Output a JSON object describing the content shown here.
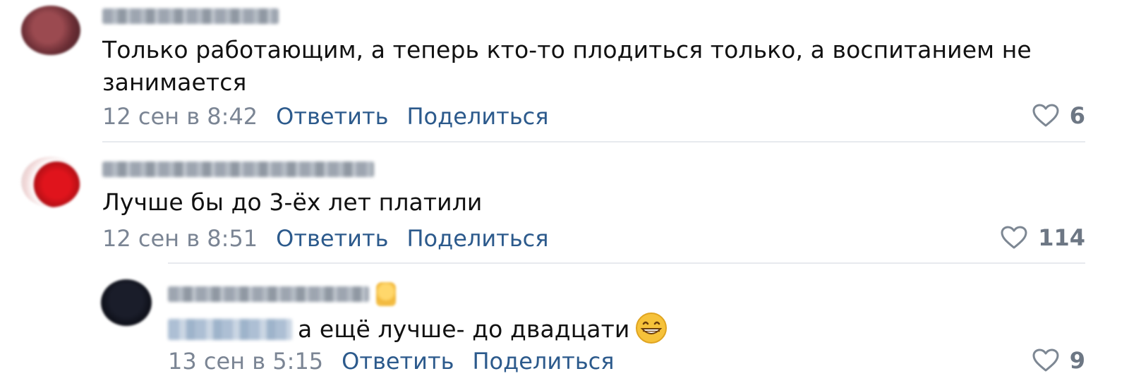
{
  "comments": [
    {
      "text": "Только работающим, а теперь кто-то плодиться только, а воспитанием не занимается",
      "time": "12 сен в 8:42",
      "reply_label": "Ответить",
      "share_label": "Поделиться",
      "likes": "6"
    },
    {
      "text": "Лучше бы до 3-ёх лет платили",
      "time": "12 сен в 8:51",
      "reply_label": "Ответить",
      "share_label": "Поделиться",
      "likes": "114"
    }
  ],
  "reply": {
    "text": "а ещё лучше- до двадцати",
    "emoji": "grinning-face",
    "time": "13 сен в 5:15",
    "reply_label": "Ответить",
    "share_label": "Поделиться",
    "likes": "9"
  },
  "colors": {
    "link": "#2c5a8c",
    "meta": "#7b8594",
    "separator": "#e7eaee"
  },
  "icons": [
    "heart-outline-icon",
    "thumbs-up-badge-icon",
    "grinning-face-emoji"
  ]
}
